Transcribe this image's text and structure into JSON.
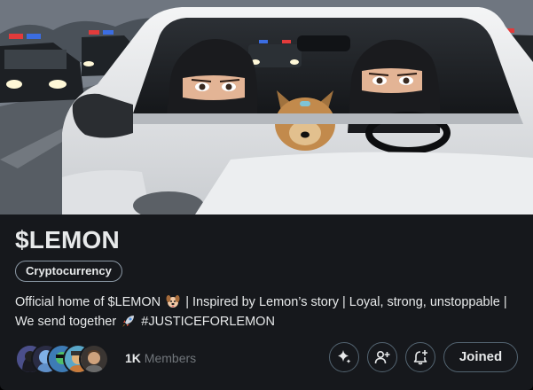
{
  "community": {
    "name": "$LEMON",
    "category": "Cryptocurrency",
    "description_part1": "Official home of $LEMON",
    "description_part2": "| Inspired by Lemon’s story | Loyal, strong, unstoppable | We send together",
    "description_part3": "#JUSTICEFORLEMON",
    "emoji_1": "dog-face-icon",
    "emoji_2": "rocket-icon"
  },
  "members": {
    "count": "1K",
    "label": "Members",
    "avatar_count": 5
  },
  "actions": {
    "sparkle_icon": "sparkle-icon",
    "invite_icon": "add-person-icon",
    "notify_icon": "bell-plus-icon",
    "joined_label": "Joined"
  },
  "colors": {
    "background": "#16181c",
    "text": "#e7e9ea",
    "muted": "#71767b",
    "border": "#536471"
  }
}
